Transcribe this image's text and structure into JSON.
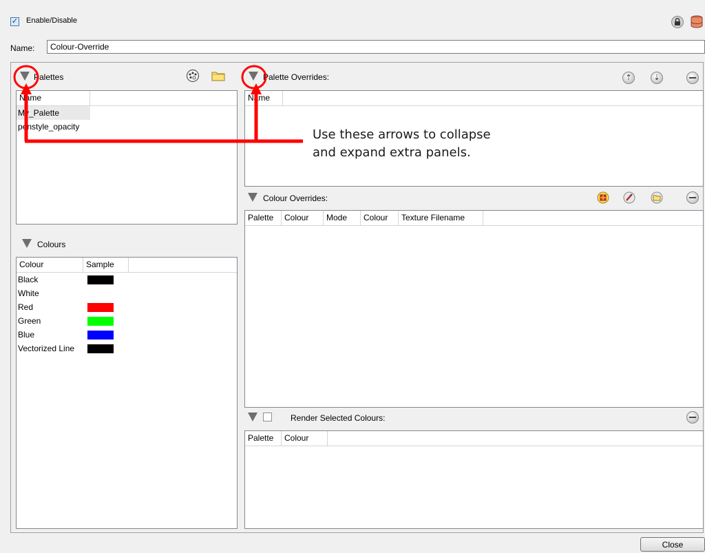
{
  "top": {
    "enable_label": "Enable/Disable",
    "enable_checked": true,
    "lock_icon": "lock-icon",
    "database_icon": "database-icon"
  },
  "name_field": {
    "label": "Name:",
    "value": "Colour-Override"
  },
  "palettes": {
    "title": "Palettes",
    "column": "Name",
    "items": [
      "My_Palette",
      "penstyle_opacity"
    ],
    "icons": [
      "palette-browser-icon",
      "folder-icon"
    ]
  },
  "colours": {
    "title": "Colours",
    "columns": [
      "Colour",
      "Sample"
    ],
    "items": [
      {
        "name": "Black",
        "swatch": "#000000"
      },
      {
        "name": "White",
        "swatch": "#ffffff"
      },
      {
        "name": "Red",
        "swatch": "#ff0000"
      },
      {
        "name": "Green",
        "swatch": "#00ff00"
      },
      {
        "name": "Blue",
        "swatch": "#0000ff"
      },
      {
        "name": "Vectorized Line",
        "swatch": "#000000"
      }
    ]
  },
  "palette_overrides": {
    "title": "Palette Overrides:",
    "column": "Name",
    "icons": [
      "move-up-icon",
      "move-down-icon",
      "remove-icon"
    ]
  },
  "colour_overrides": {
    "title": "Colour Overrides:",
    "columns": [
      "Palette",
      "Colour",
      "Mode",
      "Colour",
      "Texture Filename"
    ],
    "icons": [
      "colour-grid-icon",
      "brush-icon",
      "folder-icon",
      "remove-icon"
    ]
  },
  "render_selected": {
    "title": "Render Selected Colours:",
    "checked": false,
    "columns": [
      "Palette",
      "Colour"
    ],
    "icons": [
      "remove-icon"
    ]
  },
  "annotation": {
    "text_line1": "Use these arrows to collapse",
    "text_line2": "and expand extra panels.",
    "color": "#ff0000"
  },
  "close_button": "Close"
}
